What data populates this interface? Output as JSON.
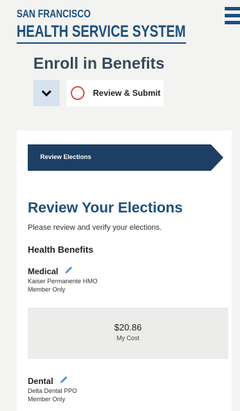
{
  "org": {
    "line1": "SAN FRANCISCO",
    "line2": "HEALTH SERVICE SYSTEM"
  },
  "page_title": "Enroll in Benefits",
  "step": {
    "label": "Review & Submit"
  },
  "breadcrumb": {
    "label": "Review Elections"
  },
  "section": {
    "title": "Review Your Elections",
    "subtitle": "Please review and verify your elections.",
    "group_title": "Health Benefits"
  },
  "benefits": [
    {
      "name": "Medical",
      "plan": "Kaiser Permanente HMO",
      "coverage": "Member Only",
      "cost": "$20.86",
      "cost_label": "My Cost"
    },
    {
      "name": "Dental",
      "plan": "Delta Dental PPO",
      "coverage": "Member Only"
    }
  ],
  "colors": {
    "brand": "#1d4f7c",
    "alert_ring": "#d9534f",
    "breadcrumb_bg": "#1d3f63"
  },
  "icons": [
    "menu-icon",
    "chevron-down-icon",
    "status-ring-icon",
    "pencil-icon"
  ]
}
